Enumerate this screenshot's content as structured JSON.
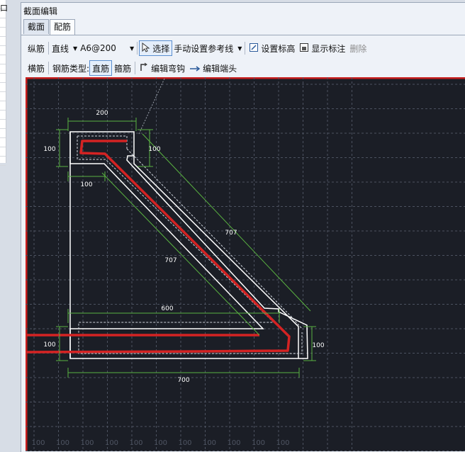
{
  "left_panel": {
    "label": "口"
  },
  "window": {
    "title": "截面编辑"
  },
  "tabs": [
    {
      "label": "截面"
    },
    {
      "label": "配筋"
    }
  ],
  "toolbar1": {
    "longitudinal": "纵筋",
    "line_mode": "直线",
    "rebar_spec": "A6@200",
    "select": "选择",
    "manual_ref": "手动设置参考线",
    "set_elevation": "设置标高",
    "show_dimension": "显示标注",
    "delete": "删除"
  },
  "toolbar2": {
    "transverse": "横筋",
    "rebar_type_label": "钢筋类型:",
    "straight": "直筋",
    "stirrup": "箍筋",
    "edit_hook": "编辑弯钩",
    "edit_end": "编辑端头"
  },
  "drawing": {
    "colors": {
      "background": "#1b1e26",
      "rebar": "#d42323",
      "outline": "#ffffff",
      "dimension": "#5ab341",
      "grid": "#4c5260",
      "border": "#c81e1e"
    },
    "dims": {
      "top_width": "200",
      "top_left_height": "100",
      "top_right_height": "100",
      "top_bottom_width": "100",
      "diagonal_outer": "707",
      "diagonal_inner": "707",
      "bottom_inner_length": "600",
      "bottom_left_height": "100",
      "bottom_right_height": "100",
      "bottom_total": "700"
    },
    "grid_labels": [
      "100",
      "100",
      "100",
      "100",
      "100",
      "100",
      "100",
      "100",
      "100",
      "100",
      "100"
    ]
  }
}
